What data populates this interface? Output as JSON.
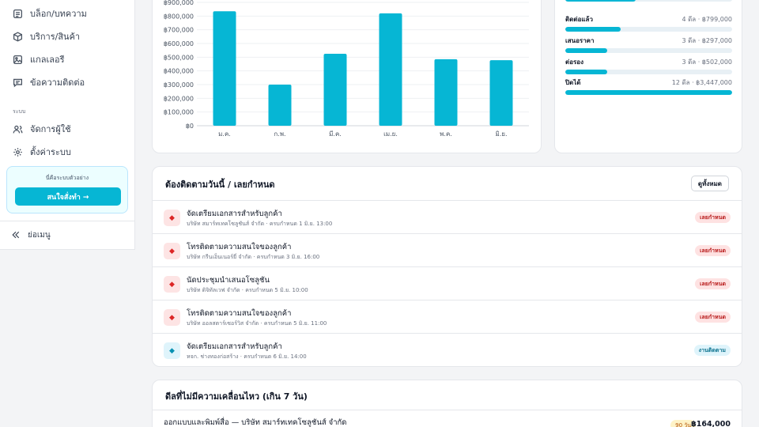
{
  "sidebar": {
    "items": [
      {
        "label": "บล็อก/บทความ",
        "icon": "blog-icon"
      },
      {
        "label": "บริการ/สินค้า",
        "icon": "box-icon"
      },
      {
        "label": "แกลเลอรี",
        "icon": "image-icon"
      },
      {
        "label": "ข้อความติดต่อ",
        "icon": "message-icon"
      }
    ],
    "section_label": "ระบบ",
    "system_items": [
      {
        "label": "จัดการผู้ใช้",
        "icon": "users-icon"
      },
      {
        "label": "ตั้งค่าระบบ",
        "icon": "gear-icon"
      }
    ],
    "promo": {
      "title": "นี่คือระบบตัวอย่าง",
      "button": "สนใจสั่งทำ →"
    },
    "collapse_label": "ย่อเมนู"
  },
  "chart_data": {
    "type": "bar",
    "categories": [
      "ม.ค.",
      "ก.พ.",
      "มี.ค.",
      "เม.ย.",
      "พ.ค.",
      "มิ.ย."
    ],
    "values": [
      835000,
      300000,
      525000,
      820000,
      485000,
      478000
    ],
    "yticks": [
      "฿0",
      "฿100,000",
      "฿200,000",
      "฿300,000",
      "฿400,000",
      "฿500,000",
      "฿600,000",
      "฿700,000",
      "฿800,000",
      "฿900,000"
    ],
    "ylim": [
      0,
      900000
    ],
    "color": "#06b6d4",
    "grid": true
  },
  "funnel": {
    "stages": [
      {
        "label": "",
        "meta": "",
        "fraction": 0.42
      },
      {
        "label": "ติดต่อแล้ว",
        "meta": "4 ดีล · ฿799,000",
        "fraction": 0.33
      },
      {
        "label": "เสนอราคา",
        "meta": "3 ดีล · ฿297,000",
        "fraction": 0.25
      },
      {
        "label": "ต่อรอง",
        "meta": "3 ดีล · ฿502,000",
        "fraction": 0.25
      },
      {
        "label": "ปิดได้",
        "meta": "12 ดีล · ฿3,447,000",
        "fraction": 1.0
      }
    ]
  },
  "followup": {
    "title": "ต้องติดตามวันนี้ / เลยกำหนด",
    "view_all": "ดูทั้งหมด",
    "tasks": [
      {
        "title": "จัดเตรียมเอกสารสำหรับลูกค้า",
        "sub": "บริษัท สมาร์ทเทคโซลูชันส์ จำกัด · ครบกำหนด 1 มิ.ย. 13:00",
        "badge": "เลยกำหนด",
        "status": "overdue"
      },
      {
        "title": "โทรติดตามความสนใจของลูกค้า",
        "sub": "บริษัท กรีนเอ็นเนอร์ยี่ จำกัด · ครบกำหนด 3 มิ.ย. 16:00",
        "badge": "เลยกำหนด",
        "status": "overdue"
      },
      {
        "title": "นัดประชุมนำเสนอโซลูชัน",
        "sub": "บริษัท ดิจิทัลเวฟ จำกัด · ครบกำหนด 5 มิ.ย. 10:00",
        "badge": "เลยกำหนด",
        "status": "overdue"
      },
      {
        "title": "โทรติดตามความสนใจของลูกค้า",
        "sub": "บริษัท ออลสตาร์เซอร์วิส จำกัด · ครบกำหนด 5 มิ.ย. 11:00",
        "badge": "เลยกำหนด",
        "status": "overdue"
      },
      {
        "title": "จัดเตรียมเอกสารสำหรับลูกค้า",
        "sub": "หจก. ช่างทองก่อสร้าง · ครบกำหนด 6 มิ.ย. 14:00",
        "badge": "งานติดตาม",
        "status": "followup"
      }
    ]
  },
  "stale": {
    "title": "ดีลที่ไม่มีความเคลื่อนไหว (เกิน 7 วัน)",
    "rows": [
      {
        "title": "ออกแบบและพิมพ์สื่อ — บริษัท สมาร์ทเทคโซลูชันส์ จำกัด",
        "days": "90 วัน",
        "amount": "฿164,000"
      }
    ]
  }
}
